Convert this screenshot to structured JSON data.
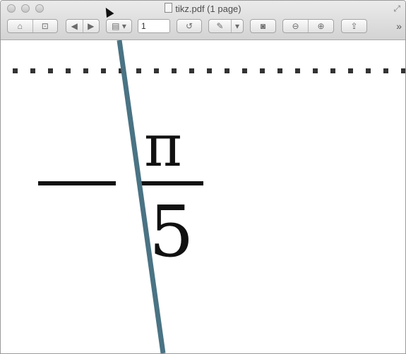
{
  "window": {
    "title": "tikz.pdf (1 page)",
    "title_icon": "pdf-document-icon"
  },
  "toolbar": {
    "page_value": "1",
    "overflow_label": "»",
    "icons": [
      "sidebar-toggle-icon",
      "bookmark-icon",
      "previous-page-icon",
      "next-page-icon",
      "view-menu-icon",
      "rotate-icon",
      "annotate-icon",
      "annotate-menu-icon",
      "stack-icon",
      "zoom-out-icon",
      "zoom-in-icon",
      "share-icon",
      "fullscreen-icon"
    ]
  },
  "document": {
    "minus": "—",
    "numerator": "π",
    "denominator": "5",
    "line_color": "#4a7384",
    "dot_color": "#333333"
  }
}
